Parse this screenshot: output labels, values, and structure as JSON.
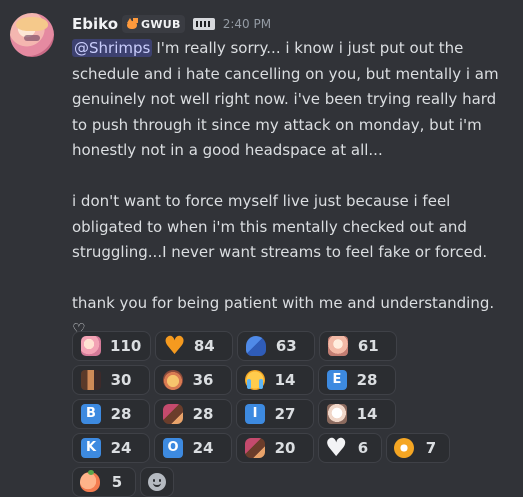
{
  "author": {
    "username": "Ebiko",
    "guild_tag": "GWUB",
    "timestamp": "2:40 PM",
    "avatar_icon": "anime-avatar",
    "badge_icon": "game-controller-badge"
  },
  "message": {
    "mention": "@Shrimps",
    "paragraphs": [
      "I'm really sorry... i know i just put out the schedule and i hate cancelling on you, but mentally i am genuinely not well right now. i've been trying really hard to push through it since my attack on monday, but i'm honestly not in a good headspace at all...",
      "i don't want to force myself live just because i feel obligated to when i'm this mentally checked out and struggling...I never want streams to feel fake or forced.",
      "thank you for being patient with me and understanding. ♡"
    ]
  },
  "reactions": [
    {
      "emoji": "anime-face-emoji",
      "count": "110"
    },
    {
      "emoji": "orange-heart-emoji",
      "count": "84"
    },
    {
      "emoji": "hugging-people-emoji",
      "count": "63"
    },
    {
      "emoji": "anime-face-2-emoji",
      "count": "61"
    },
    {
      "emoji": "pixel-art-emoji",
      "count": "30"
    },
    {
      "emoji": "cat-emoji",
      "count": "36"
    },
    {
      "emoji": "crying-face-emoji",
      "count": "14"
    },
    {
      "emoji": "letter-e-emoji",
      "letter": "E",
      "count": "28"
    },
    {
      "emoji": "letter-b-emoji",
      "letter": "B",
      "count": "28"
    },
    {
      "emoji": "dancing-couple-emoji",
      "count": "28"
    },
    {
      "emoji": "letter-i-emoji",
      "letter": "I",
      "count": "27"
    },
    {
      "emoji": "manga-face-emoji",
      "count": "14"
    },
    {
      "emoji": "letter-k-emoji",
      "letter": "K",
      "count": "24"
    },
    {
      "emoji": "letter-o-emoji",
      "letter": "O",
      "count": "24"
    },
    {
      "emoji": "dancing-couple-2-emoji",
      "count": "20"
    },
    {
      "emoji": "white-heart-emoji",
      "count": "6"
    },
    {
      "emoji": "coin-emoji",
      "count": "7"
    },
    {
      "emoji": "peach-emoji",
      "count": "5"
    }
  ],
  "add_reaction_icon": "add-reaction-icon"
}
